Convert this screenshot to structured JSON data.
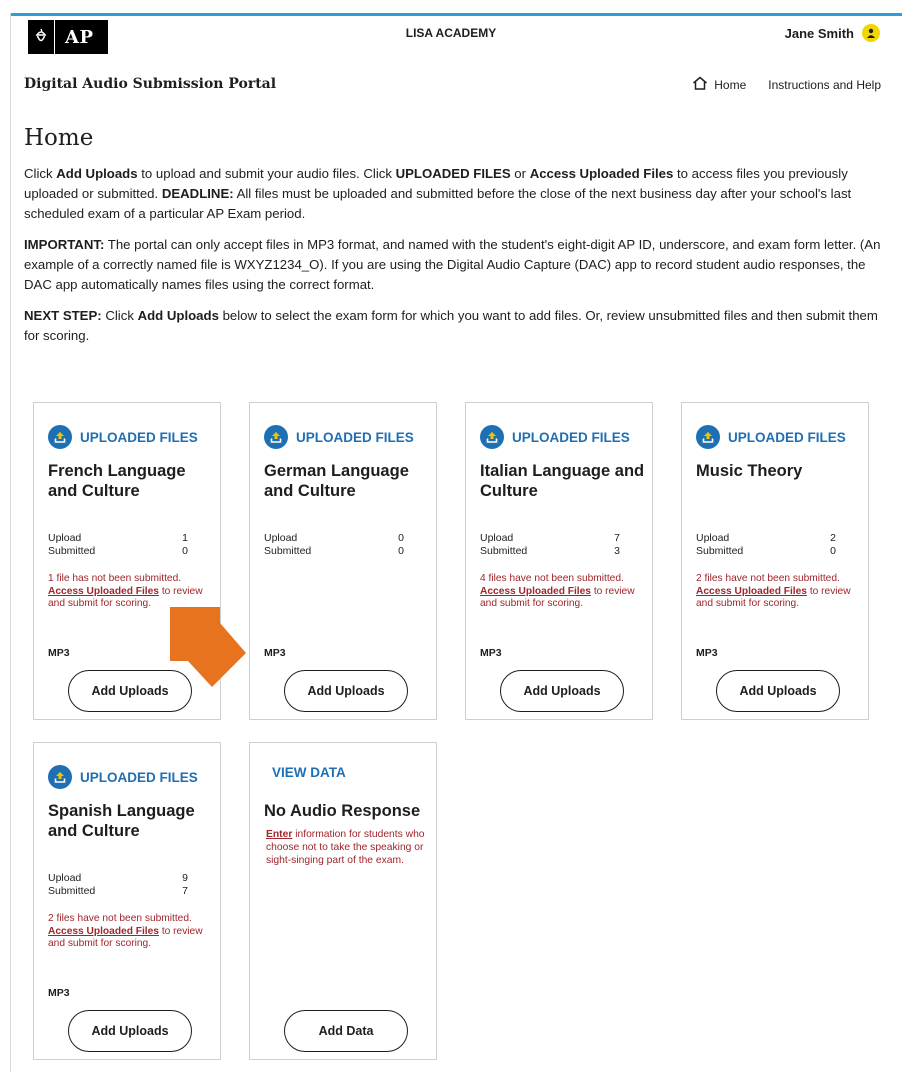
{
  "header": {
    "logo_text": "AP",
    "school": "LISA ACADEMY",
    "user_name": "Jane Smith"
  },
  "portal": {
    "title": "Digital Audio Submission Portal",
    "nav": {
      "home": "Home",
      "help": "Instructions and Help"
    }
  },
  "page": {
    "title": "Home",
    "p1": {
      "a": "Click ",
      "b": "Add Uploads",
      "c": " to upload and submit your audio files. Click ",
      "d": "UPLOADED FILES",
      "e": " or ",
      "f": "Access Uploaded Files",
      "g": " to access files you previously uploaded or submitted. ",
      "h": "DEADLINE:",
      "i": " All files must be uploaded and submitted before the close of the next business day after your school's last scheduled exam of a particular AP Exam period."
    },
    "p2": {
      "a": "IMPORTANT:",
      "b": " The portal can only accept files in MP3 format, and named with the student's eight-digit AP ID, underscore, and exam form letter. (An example of a correctly named file is WXYZ1234_O). If you are using the Digital Audio Capture (DAC) app to record student audio responses, the DAC app automatically names files using the correct format."
    },
    "p3": {
      "a": "NEXT STEP:",
      "b": " Click ",
      "c": "Add Uploads",
      "d": " below to select the exam form for which you want to add files. Or, review unsubmitted files and then submit them for scoring."
    }
  },
  "cards": [
    {
      "header": "UPLOADED FILES",
      "title": "French Language and Culture",
      "upload_label": "Upload",
      "upload": "1",
      "submitted_label": "Submitted",
      "submitted": "0",
      "warn_pre": "1 file has not been submitted. ",
      "warn_link": "Access Uploaded Files",
      "warn_post": " to review and submit for scoring.",
      "format": "MP3",
      "button": "Add Uploads"
    },
    {
      "header": "UPLOADED FILES",
      "title": "German Language and Culture",
      "upload_label": "Upload",
      "upload": "0",
      "submitted_label": "Submitted",
      "submitted": "0",
      "format": "MP3",
      "button": "Add Uploads"
    },
    {
      "header": "UPLOADED FILES",
      "title": "Italian Language and Culture",
      "upload_label": "Upload",
      "upload": "7",
      "submitted_label": "Submitted",
      "submitted": "3",
      "warn_pre": "4 files have not been submitted. ",
      "warn_link": "Access Uploaded Files",
      "warn_post": " to review and submit for scoring.",
      "format": "MP3",
      "button": "Add Uploads"
    },
    {
      "header": "UPLOADED FILES",
      "title": "Music Theory",
      "upload_label": "Upload",
      "upload": "2",
      "submitted_label": "Submitted",
      "submitted": "0",
      "warn_pre": "2 files have not been submitted. ",
      "warn_link": "Access Uploaded Files",
      "warn_post": " to review and submit for scoring.",
      "format": "MP3",
      "button": "Add Uploads"
    },
    {
      "header": "UPLOADED FILES",
      "title": "Spanish Language and Culture",
      "upload_label": "Upload",
      "upload": "9",
      "submitted_label": "Submitted",
      "submitted": "7",
      "warn_pre": "2 files have not been submitted. ",
      "warn_link": "Access Uploaded Files",
      "warn_post": " to review and submit for scoring.",
      "format": "MP3",
      "button": "Add Uploads"
    }
  ],
  "no_audio": {
    "header": "VIEW DATA",
    "title": "No Audio Response",
    "link": "Enter",
    "text": " information for students who choose not to take the speaking or sight-singing part of the exam.",
    "button": "Add Data"
  },
  "icons": {
    "logo": "acorn-icon",
    "avatar": "user-icon",
    "home": "home-icon",
    "upload": "upload-circle-icon",
    "pointer": "orange-arrow-icon"
  },
  "colors": {
    "accent_blue": "#1f6fb5",
    "top_line": "#2a9fd8",
    "warning_red": "#a0262b",
    "avatar_yellow": "#f2d600",
    "arrow_orange": "#e8731f"
  }
}
